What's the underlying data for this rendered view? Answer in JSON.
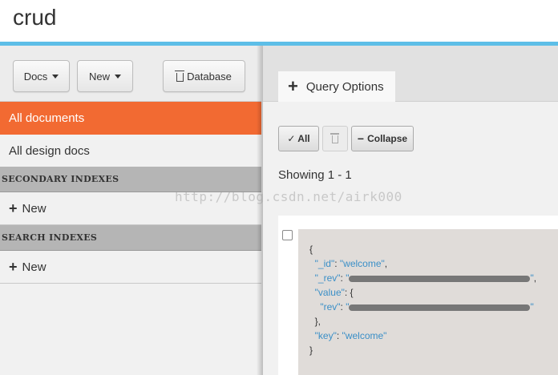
{
  "app": {
    "title": "crud"
  },
  "toolbar": {
    "docs_label": "Docs",
    "new_label": "New",
    "database_label": "Database"
  },
  "sidebar": {
    "all_documents": "All documents",
    "all_design_docs": "All design docs",
    "secondary_indexes": "SECONDARY INDEXES",
    "secondary_new": "New",
    "search_indexes": "SEARCH INDEXES",
    "search_new": "New"
  },
  "main": {
    "query_options_tab": "Query Options",
    "select_all_label": "✓ All",
    "collapse_label": "Collapse",
    "showing": "Showing 1 - 1"
  },
  "document": {
    "open_brace": "{",
    "id_key": "\"_id\"",
    "id_value": "\"welcome\"",
    "rev_key": "\"_rev\"",
    "value_key": "\"value\"",
    "inner_rev_key": "\"rev\"",
    "key_key": "\"key\"",
    "key_value": "\"welcome\"",
    "close_brace": "}"
  },
  "watermark": "http://blog.csdn.net/airk000",
  "colors": {
    "accent": "#5dbee7",
    "active_nav": "#f26a32",
    "json_key": "#3a8fc7"
  }
}
